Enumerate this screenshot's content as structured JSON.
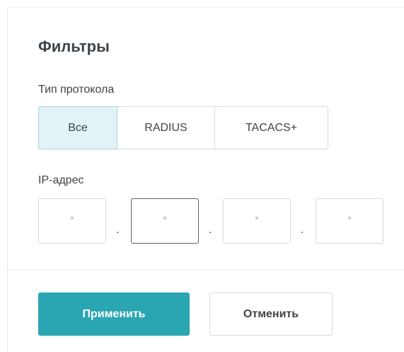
{
  "filters": {
    "title": "Фильтры",
    "protocol": {
      "label": "Тип протокола",
      "options": [
        "Все",
        "RADIUS",
        "TACACS+"
      ],
      "selected": "Все"
    },
    "ip": {
      "label": "IP-адрес",
      "octets": [
        {
          "value": "",
          "placeholder": "*"
        },
        {
          "value": "",
          "placeholder": "*"
        },
        {
          "value": "",
          "placeholder": "*"
        },
        {
          "value": "",
          "placeholder": "*"
        }
      ],
      "separator": "."
    }
  },
  "actions": {
    "apply_label": "Применить",
    "cancel_label": "Отменить"
  },
  "colors": {
    "accent": "#2aa6b2",
    "selected_bg": "#e2f2f6",
    "border": "#d6dadd",
    "text": "#3d4449"
  }
}
